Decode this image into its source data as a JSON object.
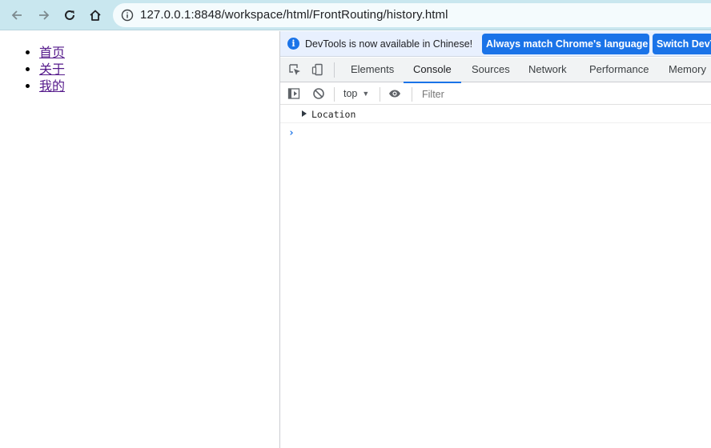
{
  "browser": {
    "url": "127.0.0.1:8848/workspace/html/FrontRouting/history.html",
    "toolbar_color": "#c9e7ef"
  },
  "page": {
    "links": [
      {
        "label": "首页"
      },
      {
        "label": "关于"
      },
      {
        "label": "我的"
      }
    ]
  },
  "devtools": {
    "infobar": {
      "message": "DevTools is now available in Chinese!",
      "button_match": "Always match Chrome's language",
      "button_switch": "Switch DevTools"
    },
    "tabs": [
      "Elements",
      "Console",
      "Sources",
      "Network",
      "Performance",
      "Memory"
    ],
    "active_tab": "Console",
    "context": "top",
    "filter_placeholder": "Filter",
    "console_entries": [
      {
        "text": "Location",
        "expandable": true
      }
    ],
    "accent_color": "#1a73e8"
  }
}
